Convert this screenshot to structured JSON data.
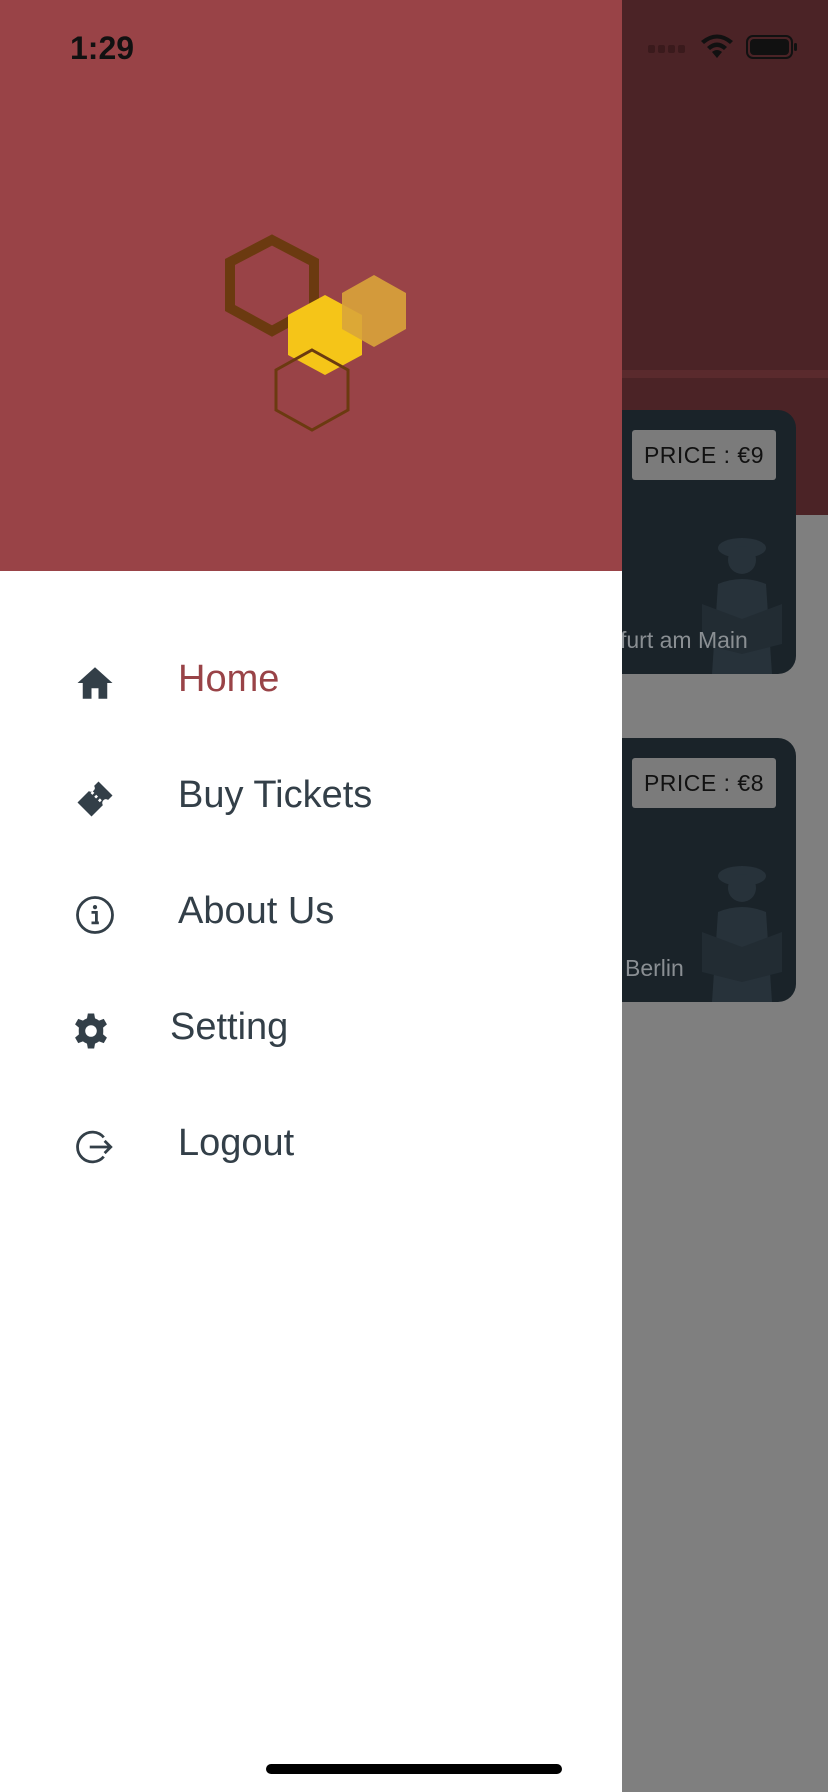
{
  "status_bar": {
    "time": "1:29"
  },
  "colors": {
    "drawer_header": "#994347",
    "active_text": "#994347",
    "menu_text": "#333f48",
    "backdrop": "#7f7f7f"
  },
  "drawer": {
    "logo_icon": "honeycomb-hexagons-logo",
    "menu": [
      {
        "label": "Home",
        "icon": "home-icon",
        "active": true
      },
      {
        "label": "Buy Tickets",
        "icon": "ticket-icon",
        "active": false
      },
      {
        "label": "About Us",
        "icon": "info-icon",
        "active": false
      },
      {
        "label": "Setting",
        "icon": "gear-icon",
        "active": false
      },
      {
        "label": "Logout",
        "icon": "logout-icon",
        "active": false
      }
    ]
  },
  "background_cards": [
    {
      "price": "PRICE : €9",
      "city": "furt am Main"
    },
    {
      "price": "PRICE : €8",
      "city": "Berlin"
    }
  ]
}
